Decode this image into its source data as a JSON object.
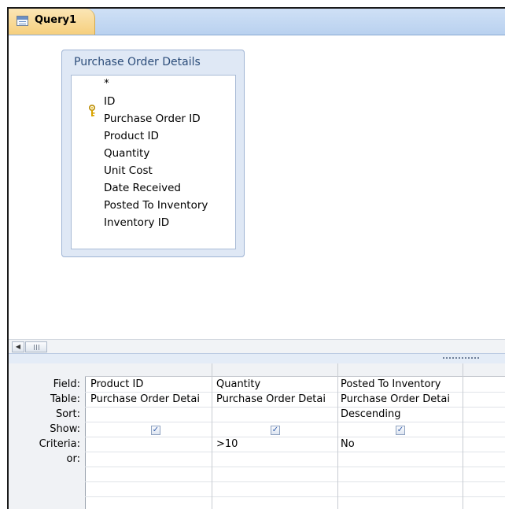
{
  "tab": {
    "title": "Query1",
    "icon": "query-icon"
  },
  "table": {
    "title": "Purchase Order Details",
    "fields": [
      {
        "label": "*",
        "is_key": false
      },
      {
        "label": "ID",
        "is_key": true
      },
      {
        "label": "Purchase Order ID",
        "is_key": false
      },
      {
        "label": "Product ID",
        "is_key": false
      },
      {
        "label": "Quantity",
        "is_key": false
      },
      {
        "label": "Unit Cost",
        "is_key": false
      },
      {
        "label": "Date Received",
        "is_key": false
      },
      {
        "label": "Posted To Inventory",
        "is_key": false
      },
      {
        "label": "Inventory ID",
        "is_key": false
      }
    ]
  },
  "grid": {
    "row_labels": {
      "field": "Field:",
      "table": "Table:",
      "sort": "Sort:",
      "show": "Show:",
      "criteria": "Criteria:",
      "or": "or:"
    },
    "columns": [
      {
        "field": "Product ID",
        "table": "Purchase Order Detai",
        "sort": "",
        "show": true,
        "criteria": ""
      },
      {
        "field": "Quantity",
        "table": "Purchase Order Detai",
        "sort": "",
        "show": true,
        "criteria": ">10"
      },
      {
        "field": "Posted To Inventory",
        "table": "Purchase Order Detai",
        "sort": "Descending",
        "show": true,
        "criteria": "No"
      }
    ]
  },
  "colors": {
    "tab_bg": "#f6cf7d",
    "tabstrip_bg": "#b9d1ef",
    "table_title": "#2c4d7a",
    "key_icon": "#d9a400"
  }
}
